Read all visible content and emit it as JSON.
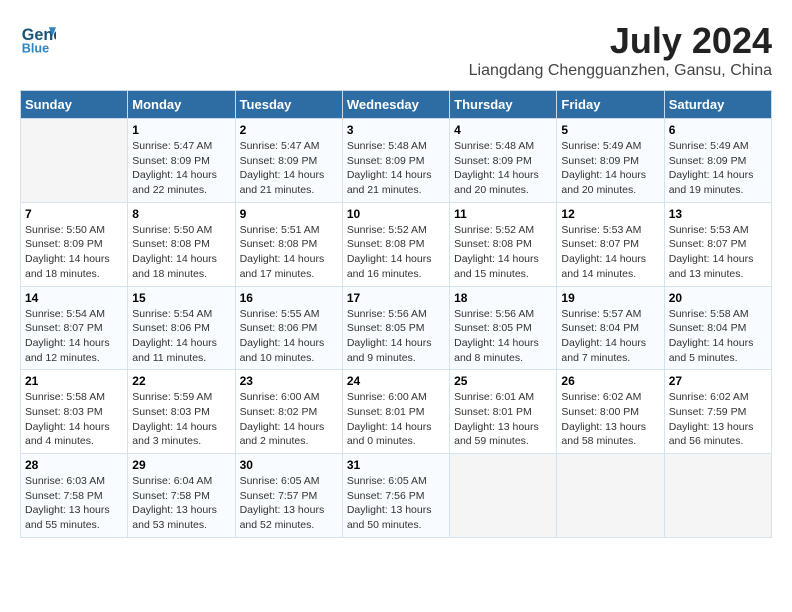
{
  "header": {
    "logo_line1": "General",
    "logo_line2": "Blue",
    "month_year": "July 2024",
    "location": "Liangdang Chengguanzhen, Gansu, China"
  },
  "weekdays": [
    "Sunday",
    "Monday",
    "Tuesday",
    "Wednesday",
    "Thursday",
    "Friday",
    "Saturday"
  ],
  "weeks": [
    [
      {
        "num": "",
        "info": ""
      },
      {
        "num": "1",
        "info": "Sunrise: 5:47 AM\nSunset: 8:09 PM\nDaylight: 14 hours\nand 22 minutes."
      },
      {
        "num": "2",
        "info": "Sunrise: 5:47 AM\nSunset: 8:09 PM\nDaylight: 14 hours\nand 21 minutes."
      },
      {
        "num": "3",
        "info": "Sunrise: 5:48 AM\nSunset: 8:09 PM\nDaylight: 14 hours\nand 21 minutes."
      },
      {
        "num": "4",
        "info": "Sunrise: 5:48 AM\nSunset: 8:09 PM\nDaylight: 14 hours\nand 20 minutes."
      },
      {
        "num": "5",
        "info": "Sunrise: 5:49 AM\nSunset: 8:09 PM\nDaylight: 14 hours\nand 20 minutes."
      },
      {
        "num": "6",
        "info": "Sunrise: 5:49 AM\nSunset: 8:09 PM\nDaylight: 14 hours\nand 19 minutes."
      }
    ],
    [
      {
        "num": "7",
        "info": "Sunrise: 5:50 AM\nSunset: 8:09 PM\nDaylight: 14 hours\nand 18 minutes."
      },
      {
        "num": "8",
        "info": "Sunrise: 5:50 AM\nSunset: 8:08 PM\nDaylight: 14 hours\nand 18 minutes."
      },
      {
        "num": "9",
        "info": "Sunrise: 5:51 AM\nSunset: 8:08 PM\nDaylight: 14 hours\nand 17 minutes."
      },
      {
        "num": "10",
        "info": "Sunrise: 5:52 AM\nSunset: 8:08 PM\nDaylight: 14 hours\nand 16 minutes."
      },
      {
        "num": "11",
        "info": "Sunrise: 5:52 AM\nSunset: 8:08 PM\nDaylight: 14 hours\nand 15 minutes."
      },
      {
        "num": "12",
        "info": "Sunrise: 5:53 AM\nSunset: 8:07 PM\nDaylight: 14 hours\nand 14 minutes."
      },
      {
        "num": "13",
        "info": "Sunrise: 5:53 AM\nSunset: 8:07 PM\nDaylight: 14 hours\nand 13 minutes."
      }
    ],
    [
      {
        "num": "14",
        "info": "Sunrise: 5:54 AM\nSunset: 8:07 PM\nDaylight: 14 hours\nand 12 minutes."
      },
      {
        "num": "15",
        "info": "Sunrise: 5:54 AM\nSunset: 8:06 PM\nDaylight: 14 hours\nand 11 minutes."
      },
      {
        "num": "16",
        "info": "Sunrise: 5:55 AM\nSunset: 8:06 PM\nDaylight: 14 hours\nand 10 minutes."
      },
      {
        "num": "17",
        "info": "Sunrise: 5:56 AM\nSunset: 8:05 PM\nDaylight: 14 hours\nand 9 minutes."
      },
      {
        "num": "18",
        "info": "Sunrise: 5:56 AM\nSunset: 8:05 PM\nDaylight: 14 hours\nand 8 minutes."
      },
      {
        "num": "19",
        "info": "Sunrise: 5:57 AM\nSunset: 8:04 PM\nDaylight: 14 hours\nand 7 minutes."
      },
      {
        "num": "20",
        "info": "Sunrise: 5:58 AM\nSunset: 8:04 PM\nDaylight: 14 hours\nand 5 minutes."
      }
    ],
    [
      {
        "num": "21",
        "info": "Sunrise: 5:58 AM\nSunset: 8:03 PM\nDaylight: 14 hours\nand 4 minutes."
      },
      {
        "num": "22",
        "info": "Sunrise: 5:59 AM\nSunset: 8:03 PM\nDaylight: 14 hours\nand 3 minutes."
      },
      {
        "num": "23",
        "info": "Sunrise: 6:00 AM\nSunset: 8:02 PM\nDaylight: 14 hours\nand 2 minutes."
      },
      {
        "num": "24",
        "info": "Sunrise: 6:00 AM\nSunset: 8:01 PM\nDaylight: 14 hours\nand 0 minutes."
      },
      {
        "num": "25",
        "info": "Sunrise: 6:01 AM\nSunset: 8:01 PM\nDaylight: 13 hours\nand 59 minutes."
      },
      {
        "num": "26",
        "info": "Sunrise: 6:02 AM\nSunset: 8:00 PM\nDaylight: 13 hours\nand 58 minutes."
      },
      {
        "num": "27",
        "info": "Sunrise: 6:02 AM\nSunset: 7:59 PM\nDaylight: 13 hours\nand 56 minutes."
      }
    ],
    [
      {
        "num": "28",
        "info": "Sunrise: 6:03 AM\nSunset: 7:58 PM\nDaylight: 13 hours\nand 55 minutes."
      },
      {
        "num": "29",
        "info": "Sunrise: 6:04 AM\nSunset: 7:58 PM\nDaylight: 13 hours\nand 53 minutes."
      },
      {
        "num": "30",
        "info": "Sunrise: 6:05 AM\nSunset: 7:57 PM\nDaylight: 13 hours\nand 52 minutes."
      },
      {
        "num": "31",
        "info": "Sunrise: 6:05 AM\nSunset: 7:56 PM\nDaylight: 13 hours\nand 50 minutes."
      },
      {
        "num": "",
        "info": ""
      },
      {
        "num": "",
        "info": ""
      },
      {
        "num": "",
        "info": ""
      }
    ]
  ]
}
